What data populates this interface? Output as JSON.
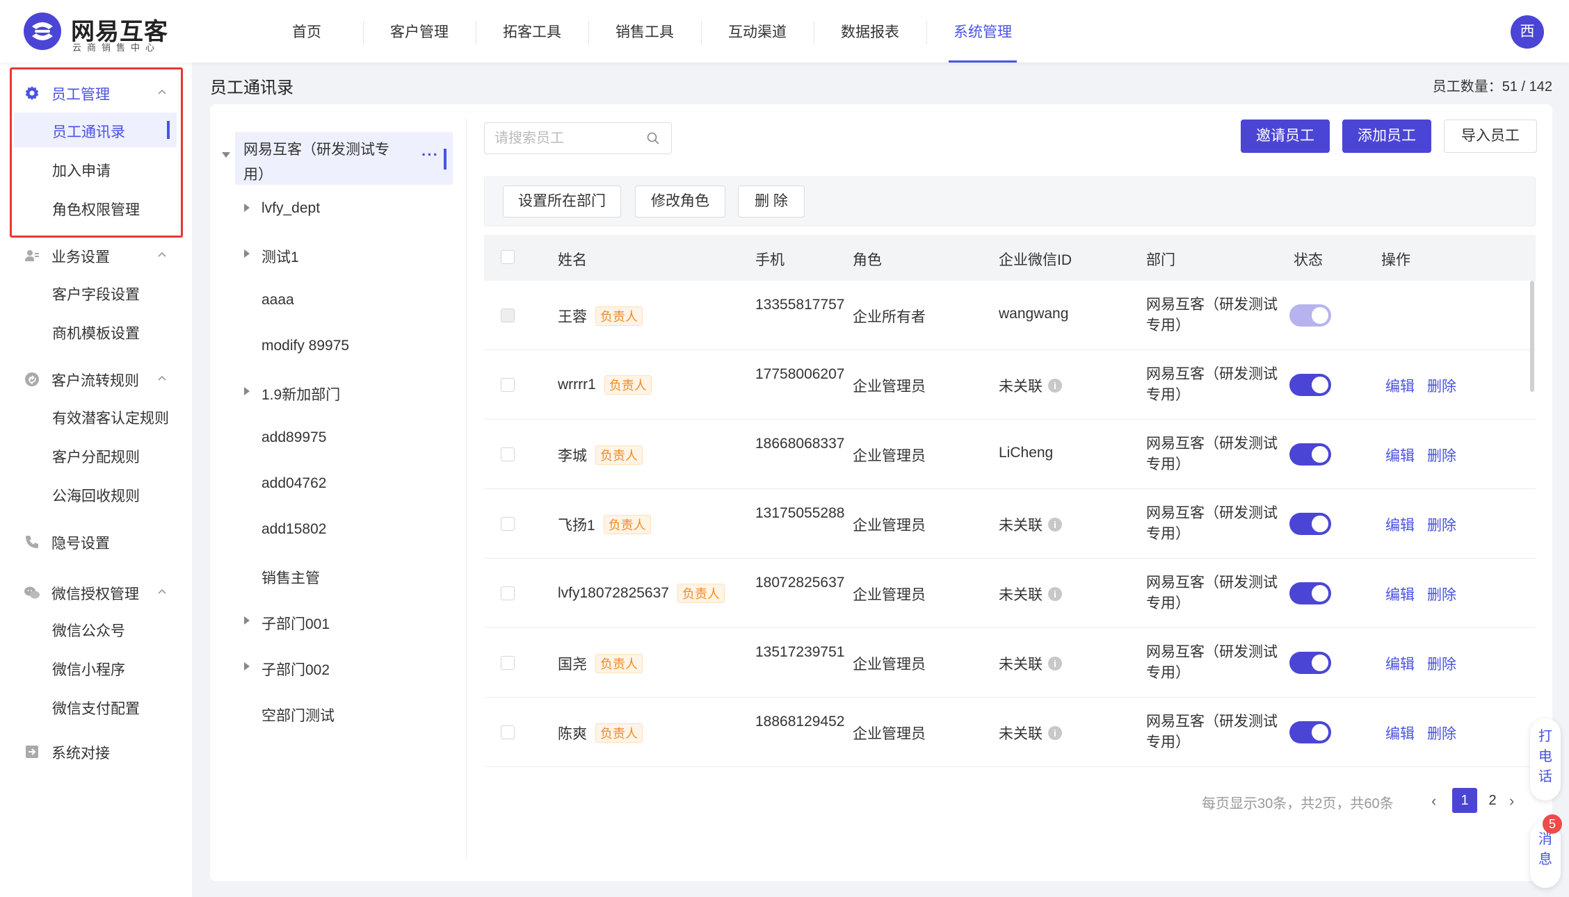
{
  "brand": {
    "name": "网易互客",
    "subtitle": "云商销售中心"
  },
  "topnav": {
    "items": [
      {
        "label": "首页"
      },
      {
        "label": "客户管理"
      },
      {
        "label": "拓客工具"
      },
      {
        "label": "销售工具"
      },
      {
        "label": "互动渠道"
      },
      {
        "label": "数据报表"
      },
      {
        "label": "系统管理",
        "active": true
      }
    ]
  },
  "user": {
    "avatar_text": "西"
  },
  "sidebar": {
    "groups": [
      {
        "label": "员工管理",
        "icon": "gear-icon",
        "items": [
          "员工通讯录",
          "加入申请",
          "角色权限管理"
        ]
      },
      {
        "label": "业务设置",
        "icon": "user-settings-icon",
        "items": [
          "客户字段设置",
          "商机模板设置"
        ]
      },
      {
        "label": "客户流转规则",
        "icon": "flow-icon",
        "items": [
          "有效潜客认定规则",
          "客户分配规则",
          "公海回收规则"
        ]
      },
      {
        "label": "隐号设置",
        "icon": "phone-icon",
        "items": []
      },
      {
        "label": "微信授权管理",
        "icon": "wechat-icon",
        "items": [
          "微信公众号",
          "微信小程序",
          "微信支付配置"
        ]
      },
      {
        "label": "系统对接",
        "icon": "login-icon",
        "items": []
      }
    ],
    "active_item": "员工通讯录"
  },
  "page": {
    "title": "员工通讯录",
    "count_label": "员工数量：51 / 142"
  },
  "tree": {
    "root": "网易互客（研发测试专用）",
    "root_more": "···",
    "nodes": [
      {
        "label": "lvfy_dept",
        "expandable": true
      },
      {
        "label": "测试1",
        "expandable": true
      },
      {
        "label": "aaaa",
        "expandable": false
      },
      {
        "label": "modify 89975",
        "expandable": false
      },
      {
        "label": "1.9新加部门",
        "expandable": true
      },
      {
        "label": "add89975",
        "expandable": false
      },
      {
        "label": "add04762",
        "expandable": false
      },
      {
        "label": "add15802",
        "expandable": false
      },
      {
        "label": "销售主管",
        "expandable": false
      },
      {
        "label": "子部门001",
        "expandable": true
      },
      {
        "label": "子部门002",
        "expandable": true
      },
      {
        "label": "空部门测试",
        "expandable": false
      }
    ]
  },
  "search": {
    "placeholder": "请搜索员工"
  },
  "actions": {
    "invite": "邀请员工",
    "add": "添加员工",
    "import": "导入员工"
  },
  "toolbar": {
    "set_dept": "设置所在部门",
    "change_role": "修改角色",
    "delete": "删 除"
  },
  "table": {
    "headers": [
      "姓名",
      "手机",
      "角色",
      "企业微信ID",
      "部门",
      "状态",
      "操作"
    ],
    "rows": [
      {
        "name": "王蓉",
        "tag": "负责人",
        "phone": "13355817757",
        "role": "企业所有者",
        "wx": "wangwang",
        "wx_info": false,
        "dept": "网易互客（研发测试专用）",
        "enabled": true,
        "locked": true,
        "ops": []
      },
      {
        "name": "wrrrr1",
        "tag": "负责人",
        "phone": "17758006207",
        "role": "企业管理员",
        "wx": "未关联",
        "wx_info": true,
        "dept": "网易互客（研发测试专用）",
        "enabled": true,
        "locked": false,
        "ops": [
          "编辑",
          "删除"
        ]
      },
      {
        "name": "李城",
        "tag": "负责人",
        "phone": "18668068337",
        "role": "企业管理员",
        "wx": "LiCheng",
        "wx_info": false,
        "dept": "网易互客（研发测试专用）",
        "enabled": true,
        "locked": false,
        "ops": [
          "编辑",
          "删除"
        ]
      },
      {
        "name": "飞扬1",
        "tag": "负责人",
        "phone": "13175055288",
        "role": "企业管理员",
        "wx": "未关联",
        "wx_info": true,
        "dept": "网易互客（研发测试专用）",
        "enabled": true,
        "locked": false,
        "ops": [
          "编辑",
          "删除"
        ]
      },
      {
        "name": "lvfy18072825637",
        "tag": "负责人",
        "phone": "18072825637",
        "role": "企业管理员",
        "wx": "未关联",
        "wx_info": true,
        "dept": "网易互客（研发测试专用）",
        "enabled": true,
        "locked": false,
        "ops": [
          "编辑",
          "删除"
        ]
      },
      {
        "name": "国尧",
        "tag": "负责人",
        "phone": "13517239751",
        "role": "企业管理员",
        "wx": "未关联",
        "wx_info": true,
        "dept": "网易互客（研发测试专用）",
        "enabled": true,
        "locked": false,
        "ops": [
          "编辑",
          "删除"
        ]
      },
      {
        "name": "陈爽",
        "tag": "负责人",
        "phone": "18868129452",
        "role": "企业管理员",
        "wx": "未关联",
        "wx_info": true,
        "dept": "网易互客（研发测试专用）",
        "enabled": true,
        "locked": false,
        "ops": [
          "编辑",
          "删除"
        ]
      }
    ]
  },
  "pagination": {
    "info": "每页显示30条，共2页，共60条",
    "pages": [
      "1",
      "2"
    ],
    "current": "1",
    "prev": "‹",
    "next": "›"
  },
  "float": {
    "call": "打电话",
    "messages": "消息",
    "badge": "5"
  },
  "colors": {
    "accent": "#4b45d6",
    "tag": "#f08a24",
    "highlight": "#e53935"
  }
}
